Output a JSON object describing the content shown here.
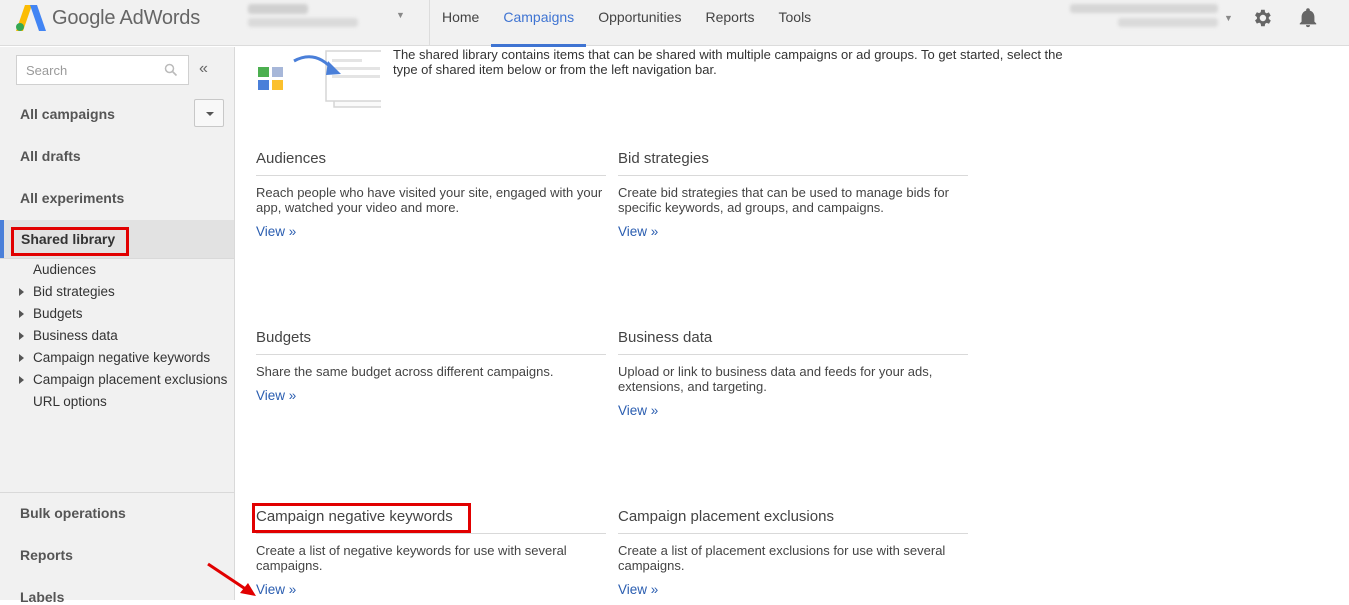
{
  "header": {
    "logo_text": "Google AdWords",
    "nav": [
      {
        "label": "Home",
        "active": false
      },
      {
        "label": "Campaigns",
        "active": true
      },
      {
        "label": "Opportunities",
        "active": false
      },
      {
        "label": "Reports",
        "active": false
      },
      {
        "label": "Tools",
        "active": false
      }
    ],
    "icons": [
      "gear-icon",
      "bell-icon"
    ],
    "accent_color": "#3f74d2"
  },
  "sidebar": {
    "search_placeholder": "Search",
    "collapse_label": "«",
    "all_campaigns": "All campaigns",
    "all_drafts": "All drafts",
    "all_experiments": "All experiments",
    "shared_library": "Shared library",
    "sub_items": [
      {
        "label": "Audiences",
        "expandable": false
      },
      {
        "label": "Bid strategies",
        "expandable": true
      },
      {
        "label": "Budgets",
        "expandable": true
      },
      {
        "label": "Business data",
        "expandable": true
      },
      {
        "label": "Campaign negative keywords",
        "expandable": true
      },
      {
        "label": "Campaign placement exclusions",
        "expandable": true
      },
      {
        "label": "URL options",
        "expandable": false
      }
    ],
    "bulk_operations": "Bulk operations",
    "reports": "Reports",
    "labels": "Labels"
  },
  "main": {
    "intro": "The shared library contains items that can be shared with multiple campaigns or ad groups. To get started, select the type of shared item below or from the left navigation bar.",
    "cards": [
      {
        "title": "Audiences",
        "description": "Reach people who have visited your site, engaged with your app, watched your video and more.",
        "link": "View »"
      },
      {
        "title": "Bid strategies",
        "description": "Create bid strategies that can be used to manage bids for specific keywords, ad groups, and campaigns.",
        "link": "View »"
      },
      {
        "title": "Budgets",
        "description": "Share the same budget across different campaigns.",
        "link": "View »"
      },
      {
        "title": "Business data",
        "description": "Upload or link to business data and feeds for your ads, extensions, and targeting.",
        "link": "View »"
      },
      {
        "title": "Campaign negative keywords",
        "description": "Create a list of negative keywords for use with several campaigns.",
        "link": "View »"
      },
      {
        "title": "Campaign placement exclusions",
        "description": "Create a list of placement exclusions for use with several campaigns.",
        "link": "View »"
      }
    ]
  },
  "annotations": {
    "highlight_color": "#e10000"
  }
}
